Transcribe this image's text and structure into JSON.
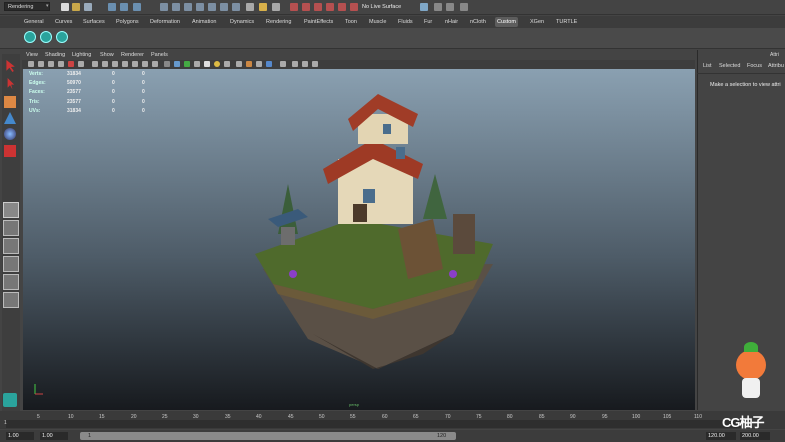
{
  "statusline": {
    "menuset": "Rendering",
    "live_surface": "No Live Surface"
  },
  "shelf_tabs": [
    {
      "label": "General"
    },
    {
      "label": "Curves"
    },
    {
      "label": "Surfaces"
    },
    {
      "label": "Polygons"
    },
    {
      "label": "Deformation"
    },
    {
      "label": "Animation"
    },
    {
      "label": "Dynamics"
    },
    {
      "label": "Rendering"
    },
    {
      "label": "PaintEffects"
    },
    {
      "label": "Toon"
    },
    {
      "label": "Muscle"
    },
    {
      "label": "Fluids"
    },
    {
      "label": "Fur"
    },
    {
      "label": "nHair"
    },
    {
      "label": "nCloth"
    },
    {
      "label": "Custom"
    },
    {
      "label": "XGen"
    },
    {
      "label": "TURTLE"
    }
  ],
  "active_shelf_tab": "Custom",
  "viewport_menu": [
    "View",
    "Shading",
    "Lighting",
    "Show",
    "Renderer",
    "Panels"
  ],
  "hud": {
    "labels": [
      "Verts:",
      "Edges:",
      "Faces:",
      "Tris:",
      "UVs:"
    ],
    "col1": [
      "31834",
      "50970",
      "23577",
      "23577",
      "31834"
    ],
    "col2": [
      "0",
      "0",
      "0",
      "0",
      "0"
    ],
    "col3": [
      "0",
      "0",
      "0",
      "0",
      "0"
    ]
  },
  "camera_label": "persp",
  "attribute_editor": {
    "title": "Attri",
    "tabs": [
      "List",
      "Selected",
      "Focus",
      "Attribu"
    ],
    "message": "Make a selection to view attri"
  },
  "time_slider": {
    "ticks": [
      "5",
      "10",
      "15",
      "20",
      "25",
      "30",
      "35",
      "40",
      "45",
      "50",
      "55",
      "60",
      "65",
      "70",
      "75",
      "80",
      "85",
      "90",
      "95",
      "100",
      "105",
      "110"
    ],
    "current_frame": "1"
  },
  "range_slider": {
    "start": "1.00",
    "start2": "1.00",
    "range_start": "1",
    "range_end": "120",
    "end": "120.00",
    "end2": "200.00"
  },
  "watermark": "CG柚子",
  "colors": {
    "accent_teal": "#2aa39c",
    "active_tab": "#5d5d5d"
  }
}
